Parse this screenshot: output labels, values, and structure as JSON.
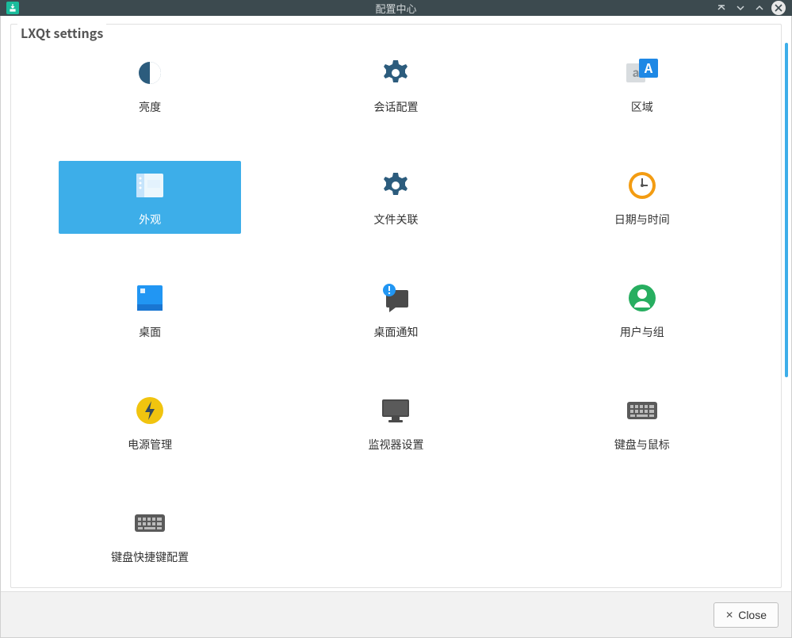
{
  "window": {
    "title": "配置中心",
    "close_label": "Close"
  },
  "group": {
    "title": "LXQt settings"
  },
  "items": [
    {
      "id": "brightness",
      "label": "亮度",
      "icon": "brightness-icon",
      "selected": false
    },
    {
      "id": "session",
      "label": "会话配置",
      "icon": "gear-icon",
      "selected": false
    },
    {
      "id": "locale",
      "label": "区域",
      "icon": "locale-icon",
      "selected": false
    },
    {
      "id": "appearance",
      "label": "外观",
      "icon": "appearance-icon",
      "selected": true
    },
    {
      "id": "file-assoc",
      "label": "文件关联",
      "icon": "gear-icon",
      "selected": false
    },
    {
      "id": "datetime",
      "label": "日期与时间",
      "icon": "clock-icon",
      "selected": false
    },
    {
      "id": "desktop",
      "label": "桌面",
      "icon": "desktop-icon",
      "selected": false
    },
    {
      "id": "notifications",
      "label": "桌面通知",
      "icon": "notification-icon",
      "selected": false
    },
    {
      "id": "users",
      "label": "用户与组",
      "icon": "user-icon",
      "selected": false
    },
    {
      "id": "power",
      "label": "电源管理",
      "icon": "power-icon",
      "selected": false
    },
    {
      "id": "monitor",
      "label": "监视器设置",
      "icon": "monitor-icon",
      "selected": false
    },
    {
      "id": "keyboard-mouse",
      "label": "键盘与鼠标",
      "icon": "keyboard-icon",
      "selected": false
    },
    {
      "id": "shortcuts",
      "label": "键盘快捷键配置",
      "icon": "keyboard-icon",
      "selected": false
    }
  ]
}
